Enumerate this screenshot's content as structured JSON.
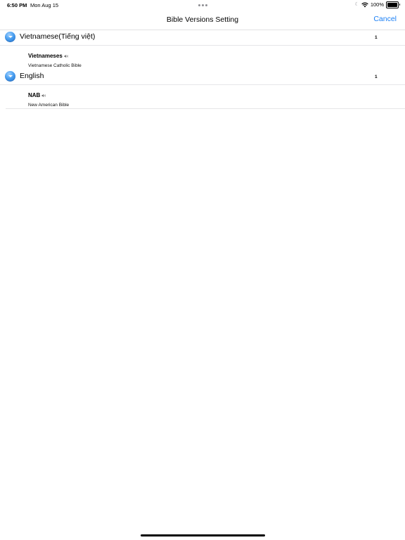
{
  "status_bar": {
    "time": "6:50 PM",
    "date": "Mon Aug 15",
    "battery": "100%"
  },
  "nav": {
    "title": "Bible Versions Setting",
    "cancel_label": "Cancel"
  },
  "sections": [
    {
      "title": "Vietnamese(Tiếng việt)",
      "count": "1",
      "versions": [
        {
          "name": "Vietnameses",
          "description": "Vietnamese Catholic Bible"
        }
      ]
    },
    {
      "title": "English",
      "count": "1",
      "versions": [
        {
          "name": "NAB",
          "description": "New American Bible"
        }
      ]
    }
  ],
  "colors": {
    "accent": "#1a7ff5",
    "section_icon": "#3f8fe8"
  },
  "icons": {
    "section_toggle": "chevron-down-circle-icon",
    "audio": "speaker-icon"
  }
}
